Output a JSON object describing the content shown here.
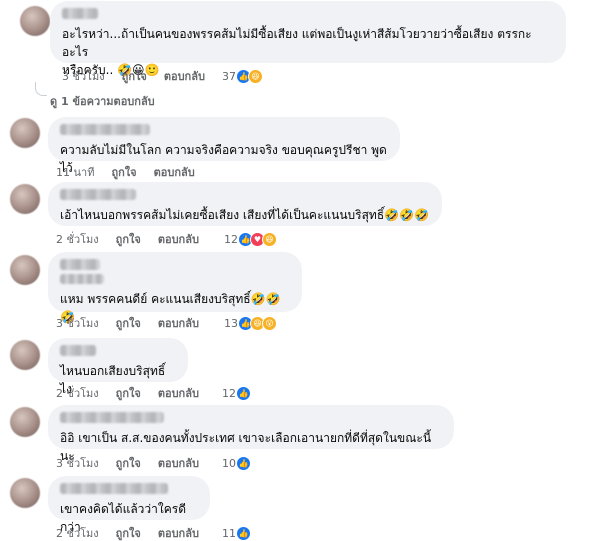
{
  "comments": [
    {
      "text": "อะไรหว่า...ถ้าเป็นคนของพรรคส้มไม่มีซื้อเสียง แต่พอเป็นงูเห่าสีส้มโวยวายว่าซื้อเสียง ตรรกะอะไร",
      "text2": "หรือครับ.. 🤣😀🙂",
      "time": "3 ชั่วโมง",
      "like": "ถูกใจ",
      "reply": "ตอบกลับ",
      "reaction_count": "37",
      "reactions": [
        "like-icon",
        "haha-icon"
      ]
    },
    {
      "text": "ความลับไม่มีในโลก ความจริงคือความจริง ขอบคุณครูปรีชา พูดไว้",
      "time": "11 นาที",
      "like": "ถูกใจ",
      "reply": "ตอบกลับ"
    },
    {
      "text": "เอ้าไหนบอกพรรคส้มไม่เคยซื้อเสียง เสียงที่ได้เป็นคะแนนบริสุทธิ์🤣🤣🤣",
      "time": "2 ชั่วโมง",
      "like": "ถูกใจ",
      "reply": "ตอบกลับ",
      "reaction_count": "12",
      "reactions": [
        "like-icon",
        "love-icon",
        "haha-icon"
      ]
    },
    {
      "text": "แหม พรรคคนดีย์ คะแนนเสียงบริสุทธิ์🤣🤣🤣",
      "time": "3 ชั่วโมง",
      "like": "ถูกใจ",
      "reply": "ตอบกลับ",
      "reaction_count": "13",
      "reactions": [
        "like-icon",
        "haha-icon",
        "wow-icon"
      ]
    },
    {
      "text": "ไหนบอกเสียงบริสุทธิ์ไง",
      "time": "2 ชั่วโมง",
      "like": "ถูกใจ",
      "reply": "ตอบกลับ",
      "reaction_count": "12",
      "reactions": [
        "like-icon"
      ]
    },
    {
      "text": "อิอิ เขาเป็น ส.ส.ของคนทั้งประเทศ เขาจะเลือกเอานายกที่ดีที่สุดในขณะนี้นะ",
      "time": "3 ชั่วโมง",
      "like": "ถูกใจ",
      "reply": "ตอบกลับ",
      "reaction_count": "10",
      "reactions": [
        "like-icon"
      ]
    },
    {
      "text": "เขาคงคิดได้แล้วว่าใครดีกว่า",
      "time": "2 ชั่วโมง",
      "like": "ถูกใจ",
      "reply": "ตอบกลับ",
      "reaction_count": "11",
      "reactions": [
        "like-icon"
      ]
    }
  ],
  "replies_link": "ดู 1 ข้อความตอบกลับ",
  "colors": {
    "like": "#1877f2",
    "love": "#f33e58",
    "haha": "#f7b125",
    "bubble": "#f0f2f5",
    "meta": "#65676b"
  }
}
